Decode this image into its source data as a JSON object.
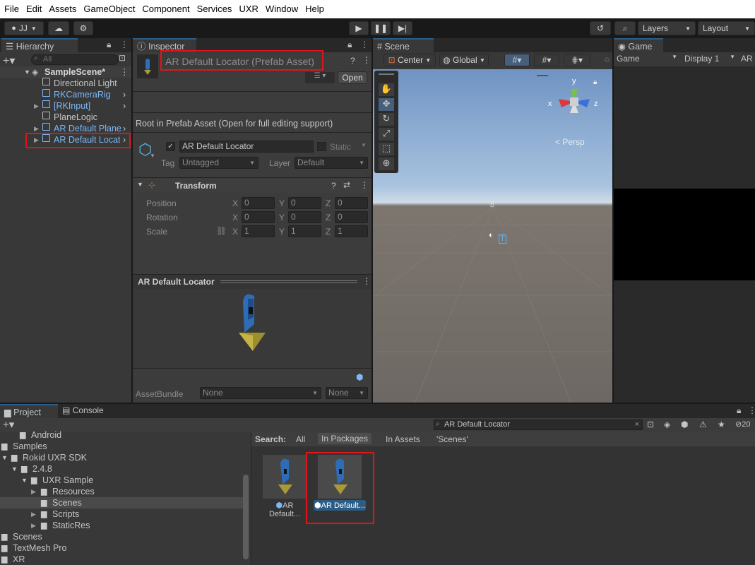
{
  "menu": [
    "File",
    "Edit",
    "Assets",
    "GameObject",
    "Component",
    "Services",
    "UXR",
    "Window",
    "Help"
  ],
  "toolbar": {
    "account": "JJ",
    "layers": "Layers",
    "layout": "Layout"
  },
  "hierarchy": {
    "tab": "Hierarchy",
    "search_placeholder": "All",
    "scene": "SampleScene*",
    "items": [
      "Directional Light",
      "RKCameraRig",
      "[RKInput]",
      "PlaneLogic",
      "AR Default Plane",
      "AR Default Locat"
    ]
  },
  "inspector": {
    "tab": "Inspector",
    "title": "AR Default Locator (Prefab Asset)",
    "open": "Open",
    "root_note": "Root in Prefab Asset (Open for full editing support)",
    "object_name": "AR Default Locator",
    "static": "Static",
    "tag_label": "Tag",
    "tag_value": "Untagged",
    "layer_label": "Layer",
    "layer_value": "Default",
    "transform": "Transform",
    "rows": [
      {
        "label": "Position",
        "x": "0",
        "y": "0",
        "z": "0"
      },
      {
        "label": "Rotation",
        "x": "0",
        "y": "0",
        "z": "0"
      },
      {
        "label": "Scale",
        "x": "1",
        "y": "1",
        "z": "1"
      }
    ],
    "axis": {
      "x": "X",
      "y": "Y",
      "z": "Z"
    },
    "preview_title": "AR Default Locator",
    "assetbundle_label": "AssetBundle",
    "assetbundle_value": "None",
    "assetbundle_variant": "None"
  },
  "scene": {
    "tab": "Scene",
    "pivot": "Center",
    "space": "Global",
    "persp": "< Persp",
    "gizmo": {
      "x": "x",
      "y": "y",
      "z": "z"
    }
  },
  "game": {
    "tab": "Game",
    "mode": "Game",
    "display": "Display 1",
    "ar": "AR"
  },
  "project": {
    "tab": "Project",
    "console_tab": "Console",
    "search_value": "AR Default Locator",
    "search_label": "Search:",
    "filters": [
      "All",
      "In Packages",
      "In Assets",
      "'Scenes'"
    ],
    "tree": [
      "Android",
      "Samples",
      "Rokid UXR SDK",
      "2.4.8",
      "UXR Sample",
      "Resources",
      "Scenes",
      "Scripts",
      "StaticRes",
      "Scenes",
      "TextMesh Pro",
      "XR"
    ],
    "assets": [
      "AR Default...",
      "AR Default..."
    ],
    "count": "20"
  },
  "colors": {
    "accent": "#2c5d87",
    "highlight": "#e0141c",
    "prefab_blue": "#7cb8f7"
  }
}
